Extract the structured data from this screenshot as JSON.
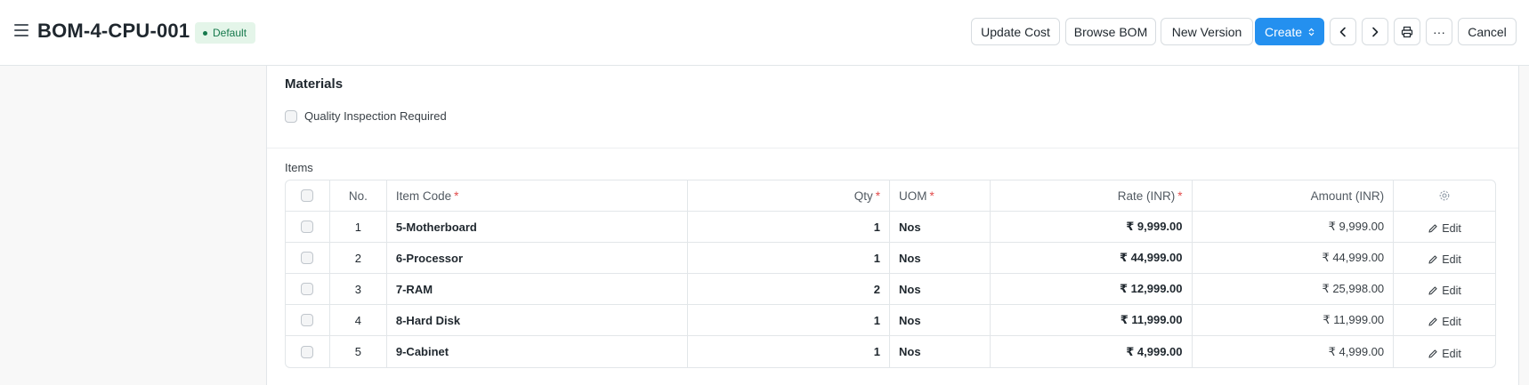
{
  "header": {
    "title": "BOM-4-CPU-001",
    "status": "Default",
    "buttons": {
      "update_cost": "Update Cost",
      "browse_bom": "Browse BOM",
      "new_version": "New Version",
      "create": "Create",
      "more": "···",
      "cancel": "Cancel"
    }
  },
  "materials": {
    "section_title": "Materials",
    "quality_inspection_label": "Quality Inspection Required",
    "quality_inspection_checked": false
  },
  "items": {
    "label": "Items",
    "columns": {
      "no": "No.",
      "item_code": "Item Code",
      "qty": "Qty",
      "uom": "UOM",
      "rate": "Rate (INR)",
      "amount": "Amount (INR)",
      "required_mark": "*"
    },
    "edit_label": "Edit",
    "rows": [
      {
        "no": "1",
        "item_code": "5-Motherboard",
        "qty": "1",
        "uom": "Nos",
        "rate": "₹ 9,999.00",
        "amount": "₹ 9,999.00"
      },
      {
        "no": "2",
        "item_code": "6-Processor",
        "qty": "1",
        "uom": "Nos",
        "rate": "₹ 44,999.00",
        "amount": "₹ 44,999.00"
      },
      {
        "no": "3",
        "item_code": "7-RAM",
        "qty": "2",
        "uom": "Nos",
        "rate": "₹ 12,999.00",
        "amount": "₹ 25,998.00"
      },
      {
        "no": "4",
        "item_code": "8-Hard Disk",
        "qty": "1",
        "uom": "Nos",
        "rate": "₹ 11,999.00",
        "amount": "₹ 11,999.00"
      },
      {
        "no": "5",
        "item_code": "9-Cabinet",
        "qty": "1",
        "uom": "Nos",
        "rate": "₹ 4,999.00",
        "amount": "₹ 4,999.00"
      }
    ]
  },
  "colors": {
    "primary": "#2490ef",
    "status_bg": "#e4f5e9",
    "status_text": "#16794c",
    "required": "#e24c4c"
  },
  "icons": {
    "menu": "hamburger-menu-icon",
    "prev": "chevron-left-icon",
    "next": "chevron-right-icon",
    "print": "printer-icon",
    "settings": "gear-icon",
    "edit": "pencil-icon"
  }
}
